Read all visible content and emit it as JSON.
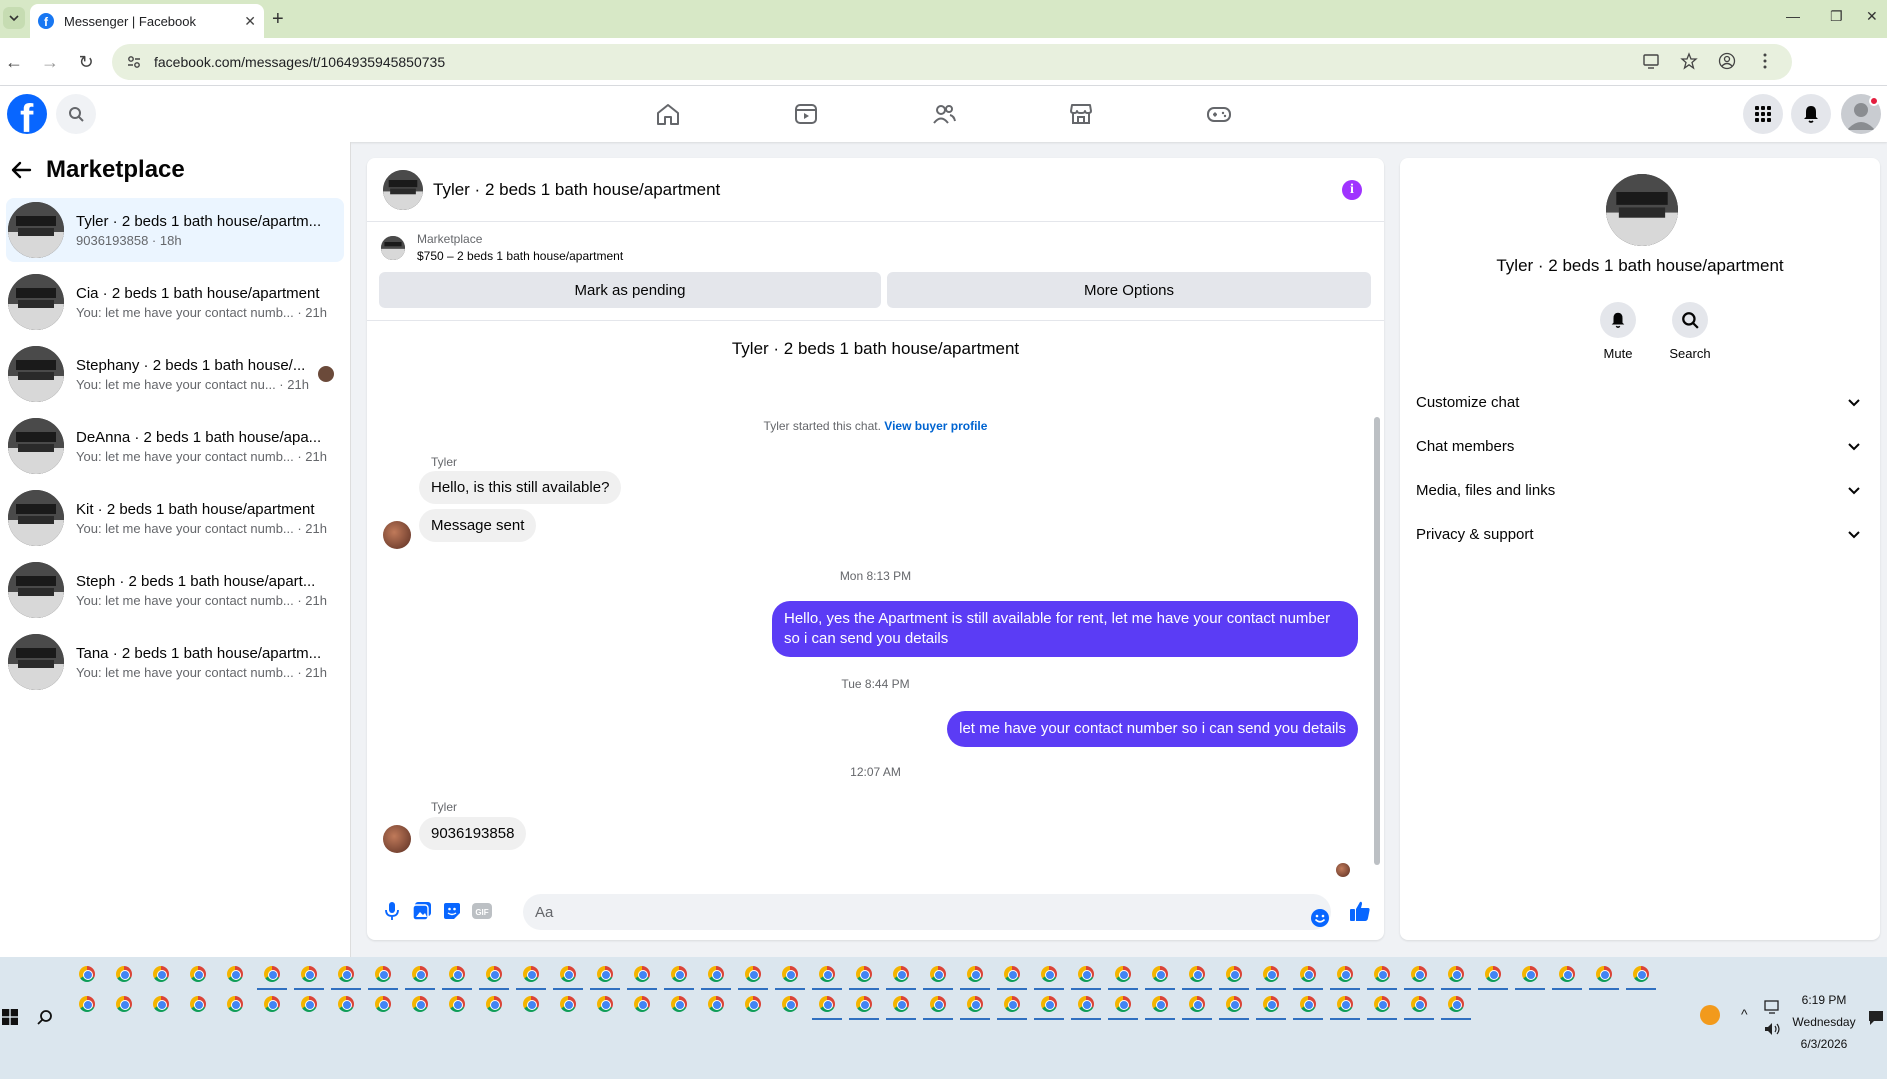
{
  "browser": {
    "tab_title": "Messenger | Facebook",
    "url": "facebook.com/messages/t/1064935945850735"
  },
  "sidebar": {
    "title": "Marketplace",
    "conversations": [
      {
        "name": "Tyler · 2 beds 1 bath house/apartm...",
        "preview": "9036193858 · 18h",
        "active": true
      },
      {
        "name": "Cia · 2 beds 1 bath house/apartment",
        "preview": "You: let me have your contact numb... · 21h"
      },
      {
        "name": "Stephany · 2 beds 1 bath house/...",
        "preview": "You: let me have your contact nu... · 21h"
      },
      {
        "name": "DeAnna · 2 beds 1 bath house/apa...",
        "preview": "You: let me have your contact numb... · 21h"
      },
      {
        "name": "Kit · 2 beds 1 bath house/apartment",
        "preview": "You: let me have your contact numb... · 21h"
      },
      {
        "name": "Steph · 2 beds 1 bath house/apart...",
        "preview": "You: let me have your contact numb... · 21h"
      },
      {
        "name": "Tana · 2 beds 1 bath house/apartm...",
        "preview": "You: let me have your contact numb... · 21h"
      }
    ]
  },
  "chat": {
    "title": "Tyler · 2 beds 1 bath house/apartment",
    "listing_label": "Marketplace",
    "listing_detail": "$750 – 2 beds 1 bath house/apartment",
    "mark_pending": "Mark as pending",
    "more_options": "More Options",
    "started_text": "Tyler started this chat.",
    "view_buyer": "View buyer profile",
    "sender_name": "Tyler",
    "msg1": "Hello, is this still available?",
    "msg2": "Message sent",
    "time1": "Mon 8:13 PM",
    "out1": "Hello, yes the Apartment is still available for rent, let me have your contact number so i can send you details",
    "time2": "Tue 8:44 PM",
    "out2": "let me have your contact number so i can send you details",
    "time3": "12:07 AM",
    "msg3": "9036193858",
    "input_placeholder": "Aa"
  },
  "details": {
    "title": "Tyler · 2 beds 1 bath house/apartment",
    "mute": "Mute",
    "search": "Search",
    "rows": [
      "Customize chat",
      "Chat members",
      "Media, files and links",
      "Privacy & support"
    ]
  },
  "taskbar": {
    "time": "6:19 PM",
    "day": "Wednesday",
    "date": "6/3/2026"
  },
  "colors": {
    "accent": "#5b3cf5",
    "facebook_blue": "#0866ff",
    "active_bg": "#ebf5ff"
  }
}
